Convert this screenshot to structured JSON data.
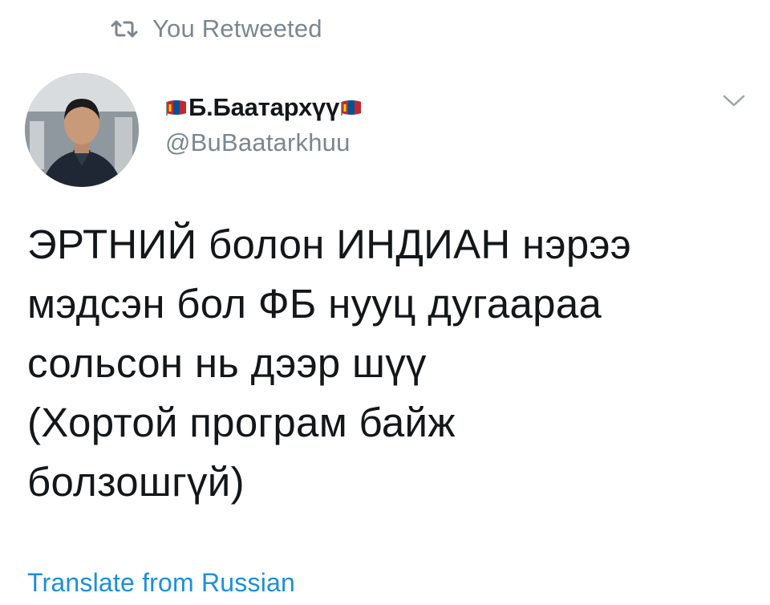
{
  "retweet": {
    "label": "You Retweeted",
    "icon": "retweet-icon"
  },
  "author": {
    "display_name": "Б.Баатархүү",
    "handle": "@BuBaatarkhuu",
    "flag_icon": "mongolia-flag-icon"
  },
  "menu": {
    "icon": "chevron-down-icon"
  },
  "tweet": {
    "text": "ЭРТНИЙ болон ИНДИАН нэрээ\nмэдсэн бол ФБ нууц дугаараа\nсольсон нь дээр шүү\n(Хортой програм байж\nболзошгүй)"
  },
  "translate": {
    "label": "Translate from Russian"
  },
  "colors": {
    "text": "#14171a",
    "muted": "#7a8791",
    "link": "#1d8fd9",
    "flag_red": "#c4272f",
    "flag_blue": "#015197",
    "flag_gold": "#f9cf02"
  }
}
